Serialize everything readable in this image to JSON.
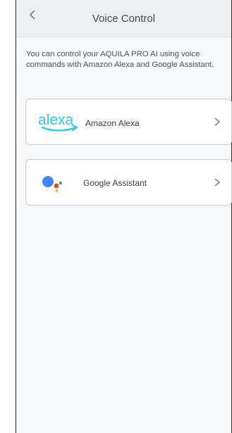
{
  "header": {
    "title": "Voice Control",
    "back_icon": "chevron-left-icon"
  },
  "description": "You can control your AQUILA PRO AI using voice commands with Amazon Alexa and Google Assistant.",
  "services": [
    {
      "label": "Amazon Alexa",
      "logo": "alexa-logo",
      "logo_text": "alexa",
      "icon": "chevron-right-icon"
    },
    {
      "label": "Google Assistant",
      "logo": "google-assistant-logo",
      "icon": "chevron-right-icon"
    }
  ],
  "colors": {
    "alexa_blue": "#31c4f3",
    "google_blue": "#4285f4",
    "google_red": "#ea4335",
    "google_yellow": "#fbbc05",
    "google_green": "#34a853"
  }
}
